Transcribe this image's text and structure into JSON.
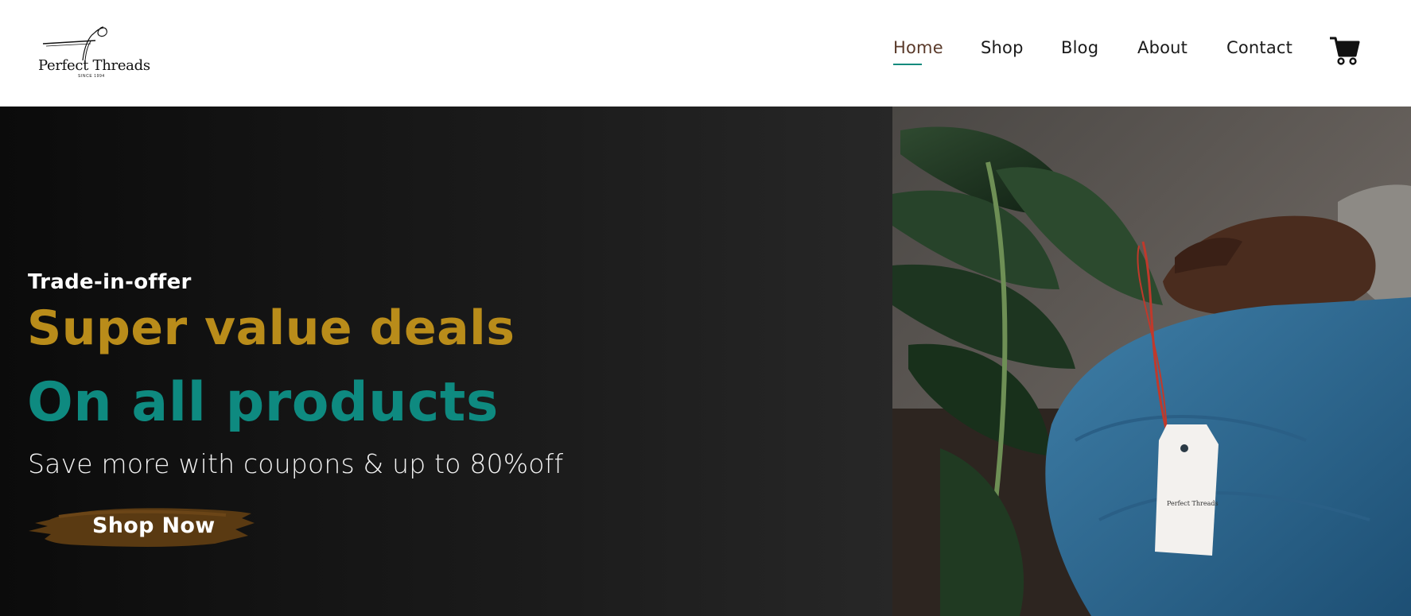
{
  "header": {
    "logo": {
      "brand": "Perfect Threads",
      "tagline": "SINCE 1994"
    },
    "nav": [
      {
        "label": "Home",
        "active": true
      },
      {
        "label": "Shop",
        "active": false
      },
      {
        "label": "Blog",
        "active": false
      },
      {
        "label": "About",
        "active": false
      },
      {
        "label": "Contact",
        "active": false
      }
    ],
    "cart_icon": "shopping-cart-icon"
  },
  "hero": {
    "eyebrow": "Trade-in-offer",
    "headline_1": "Super value deals",
    "headline_2": "On all products",
    "subtext": "Save more with coupons & up to 80%off",
    "cta_label": "Shop Now",
    "image_tag_brand": "Perfect Threads"
  },
  "colors": {
    "gold": "#b98c1a",
    "teal": "#0e8a80",
    "brush": "#5a3a12",
    "active_underline": "#0e8a7d"
  }
}
